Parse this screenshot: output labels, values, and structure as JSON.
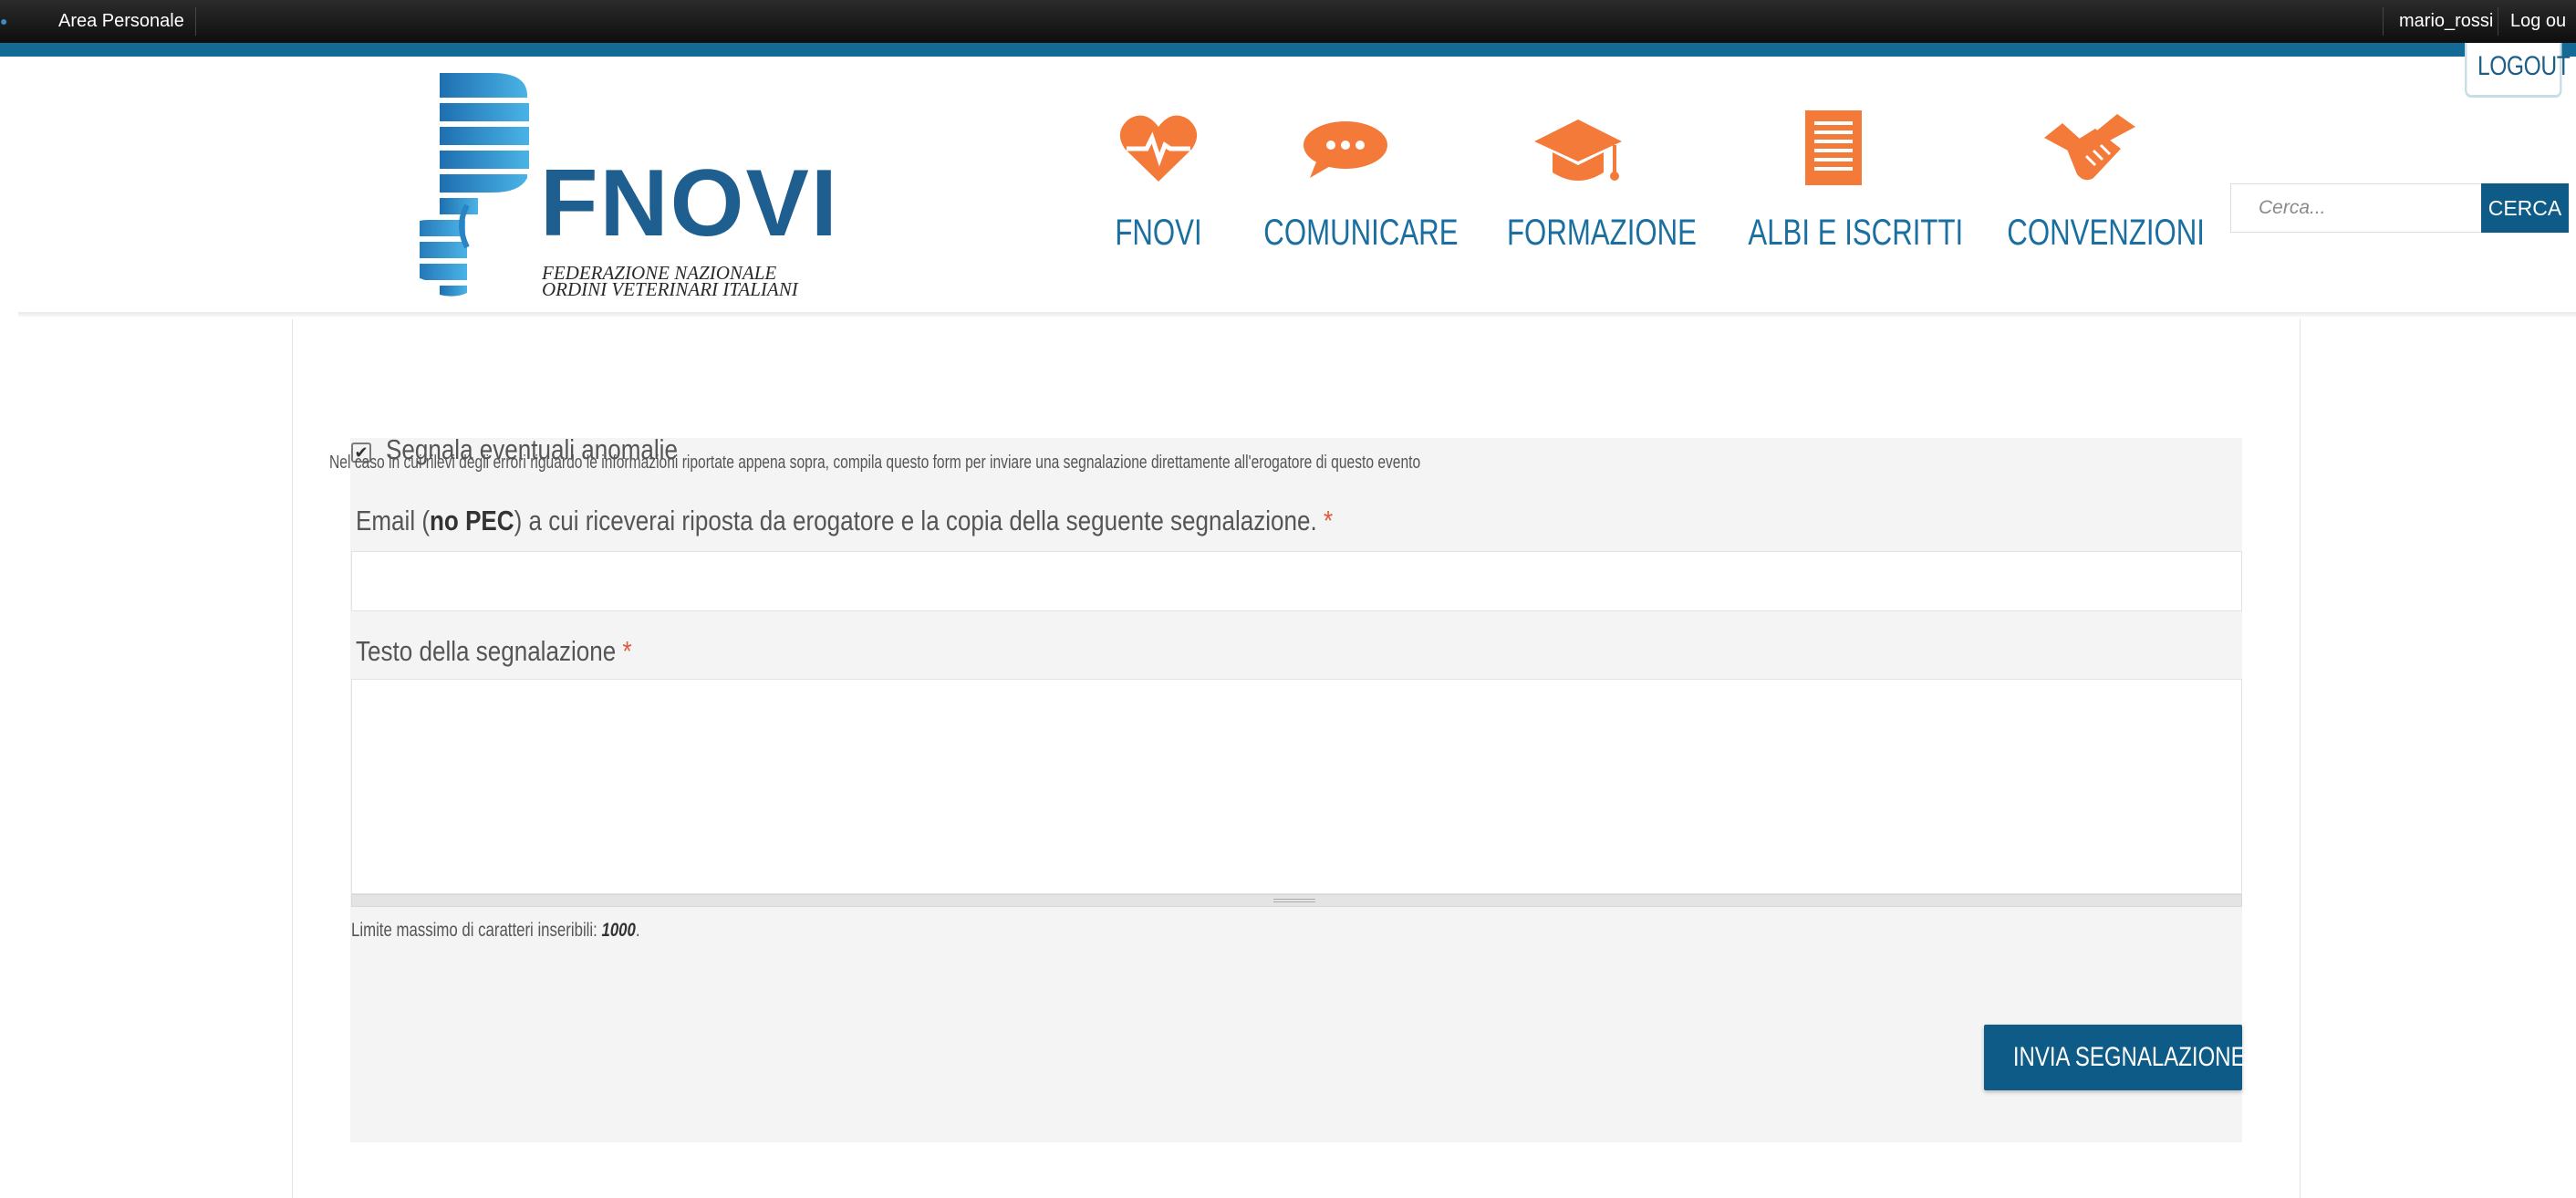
{
  "toolbar": {
    "area_label": "Area Personale",
    "username": "mario_rossi",
    "logout_label": "Log ou"
  },
  "header": {
    "logout_button": "LOGOUT",
    "logo": {
      "name": "FNOVI",
      "subtitle_line1": "FEDERAZIONE NAZIONALE",
      "subtitle_line2": "ORDINI VETERINARI ITALIANI"
    },
    "nav": [
      {
        "label": "FNOVI",
        "icon": "heart-pulse-icon"
      },
      {
        "label": "COMUNICARE",
        "icon": "chat-bubble-icon"
      },
      {
        "label": "FORMAZIONE",
        "icon": "graduation-cap-icon"
      },
      {
        "label": "ALBI E ISCRITTI",
        "icon": "document-list-icon"
      },
      {
        "label": "CONVENZIONI",
        "icon": "handshake-icon"
      }
    ],
    "search": {
      "placeholder": "Cerca...",
      "button_label": "CERCA"
    }
  },
  "form": {
    "checkbox_label": "Segnala eventuali anomalie",
    "checkbox_checked": true,
    "intro": "Nel caso in cui rilevi degli errori riguardo le informazioni riportate appena sopra, compila questo form per inviare una segnalazione direttamente all'erogatore di questo evento",
    "email_label_prefix": "Email (",
    "email_label_bold": "no PEC",
    "email_label_suffix": ") a cui riceverai riposta da erogatore e la copia della seguente segnalazione.",
    "required_mark": "*",
    "email_value": "",
    "testo_label": "Testo della segnalazione",
    "testo_value": "",
    "limit_prefix": "Limite massimo di caratteri inseribili: ",
    "limit_value": "1000",
    "limit_suffix": ".",
    "submit_label": "INVIA SEGNALAZIONE"
  },
  "colors": {
    "brand_blue": "#0d5b86",
    "nav_blue": "#1a6fa0",
    "icon_orange": "#f47a3a",
    "required_red": "#e05a3a"
  }
}
